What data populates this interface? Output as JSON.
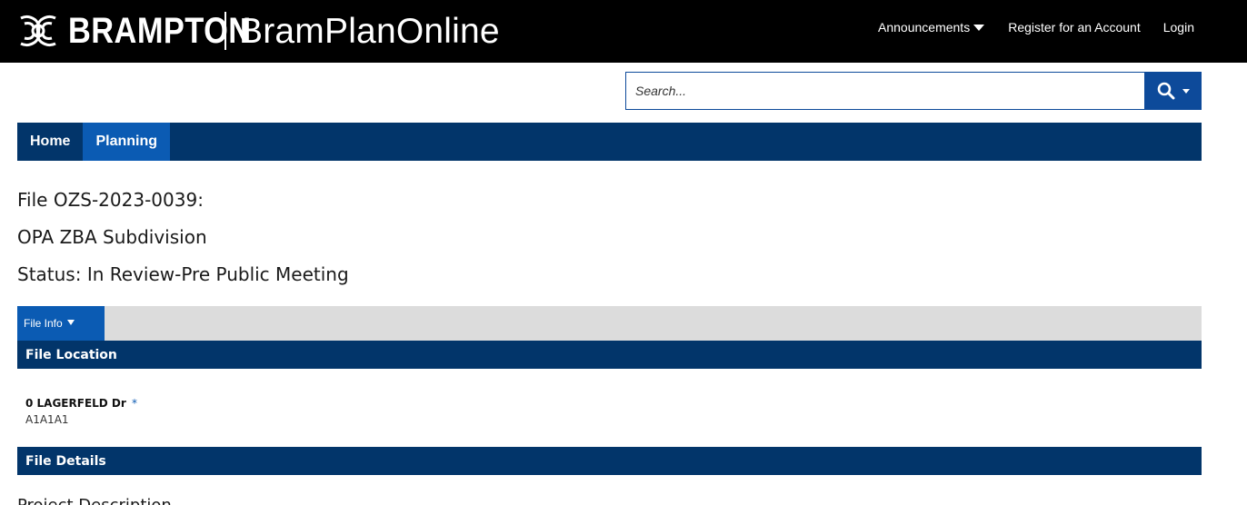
{
  "header": {
    "logo_text": "BRAMPTON",
    "app_name": "BramPlanOnline",
    "nav": {
      "announcements": "Announcements",
      "register": "Register for an Account",
      "login": "Login"
    }
  },
  "search": {
    "placeholder": "Search..."
  },
  "main_nav": {
    "items": [
      {
        "label": "Home"
      },
      {
        "label": "Planning"
      }
    ],
    "active": "Planning"
  },
  "record": {
    "file_line": "File OZS-2023-0039:",
    "type_line": "OPA ZBA Subdivision",
    "status_line": "Status: In Review-Pre Public Meeting"
  },
  "tabs": {
    "file_info": "File Info"
  },
  "sections": {
    "file_location": "File Location",
    "file_details": "File Details"
  },
  "location": {
    "address": "0 LAGERFELD Dr",
    "marker": "*",
    "postal": "A1A1A1"
  },
  "details": {
    "partial_heading": "Project Description"
  },
  "colors": {
    "header_bg": "#000000",
    "nav_bg": "#02356a",
    "active_blue": "#0b5bb3",
    "search_blue": "#0d4a9a",
    "tabbar_bg": "#dcdcdc"
  }
}
